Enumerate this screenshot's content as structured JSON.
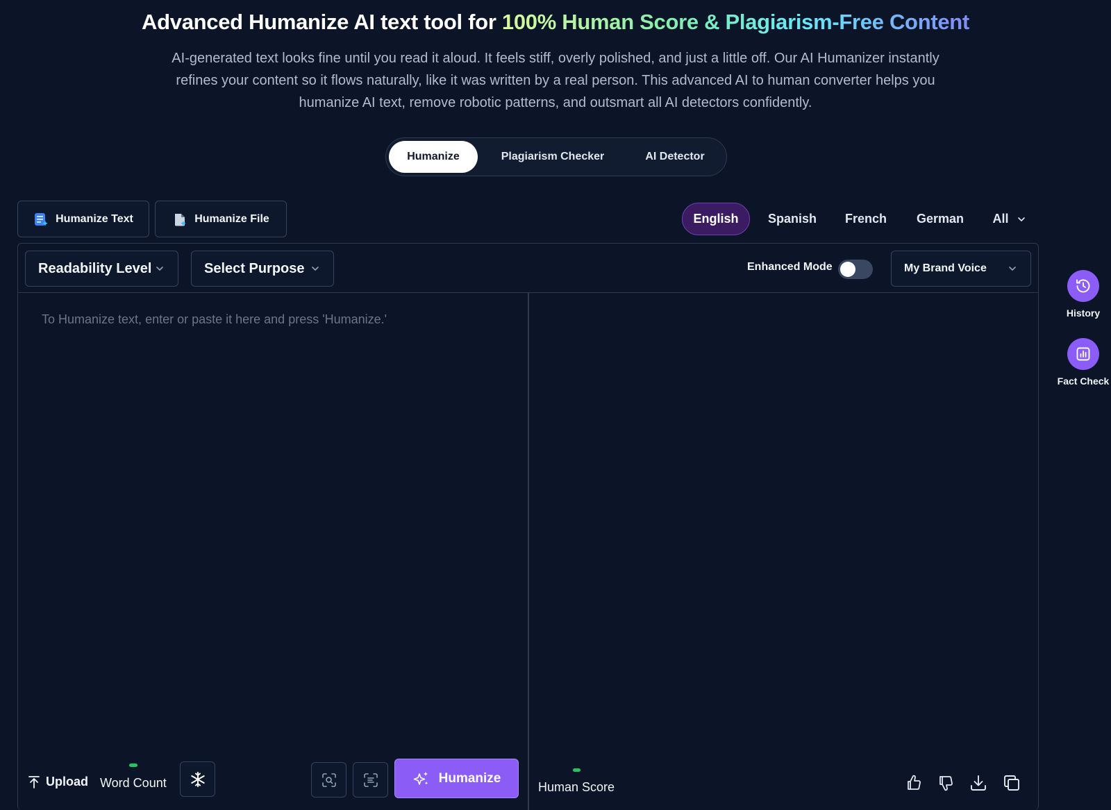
{
  "hero": {
    "title_plain": "Advanced Humanize AI text tool for ",
    "title_highlight": "100% Human Score & Plagiarism-Free Content",
    "description": "AI-generated text looks fine until you read it aloud. It feels stiff, overly polished, and just a little off. Our AI Humanizer instantly refines your content so it flows naturally, like it was written by a real person. This advanced AI to human converter helps you humanize AI text, remove robotic patterns, and outsmart all AI detectors confidently."
  },
  "mode_tabs": [
    {
      "label": "Humanize",
      "active": true
    },
    {
      "label": "Plagiarism Checker",
      "active": false
    },
    {
      "label": "AI Detector",
      "active": false
    }
  ],
  "input_types": {
    "text_label": "Humanize Text",
    "file_label": "Humanize File"
  },
  "languages": {
    "items": [
      "English",
      "Spanish",
      "French",
      "German"
    ],
    "active": "English",
    "all_label": "All"
  },
  "toolbar": {
    "readability_label": "Readability Level",
    "purpose_label": "Select Purpose",
    "enhanced_mode_label": "Enhanced Mode",
    "enhanced_mode_on": false,
    "brand_voice_label": "My Brand Voice"
  },
  "editor": {
    "placeholder": "To Humanize text, enter or paste it here and press 'Humanize.'",
    "value": ""
  },
  "bottom_left": {
    "upload_label": "Upload",
    "word_count_label": "Word Count",
    "humanize_button_label": "Humanize"
  },
  "bottom_right": {
    "human_score_label": "Human Score"
  },
  "side": {
    "history_label": "History",
    "fact_check_label": "Fact Check"
  },
  "colors": {
    "background": "#0c1527",
    "accent": "#8b5cf6",
    "active_language_bg": "#3b1c63",
    "indicator_green": "#22c55e"
  }
}
